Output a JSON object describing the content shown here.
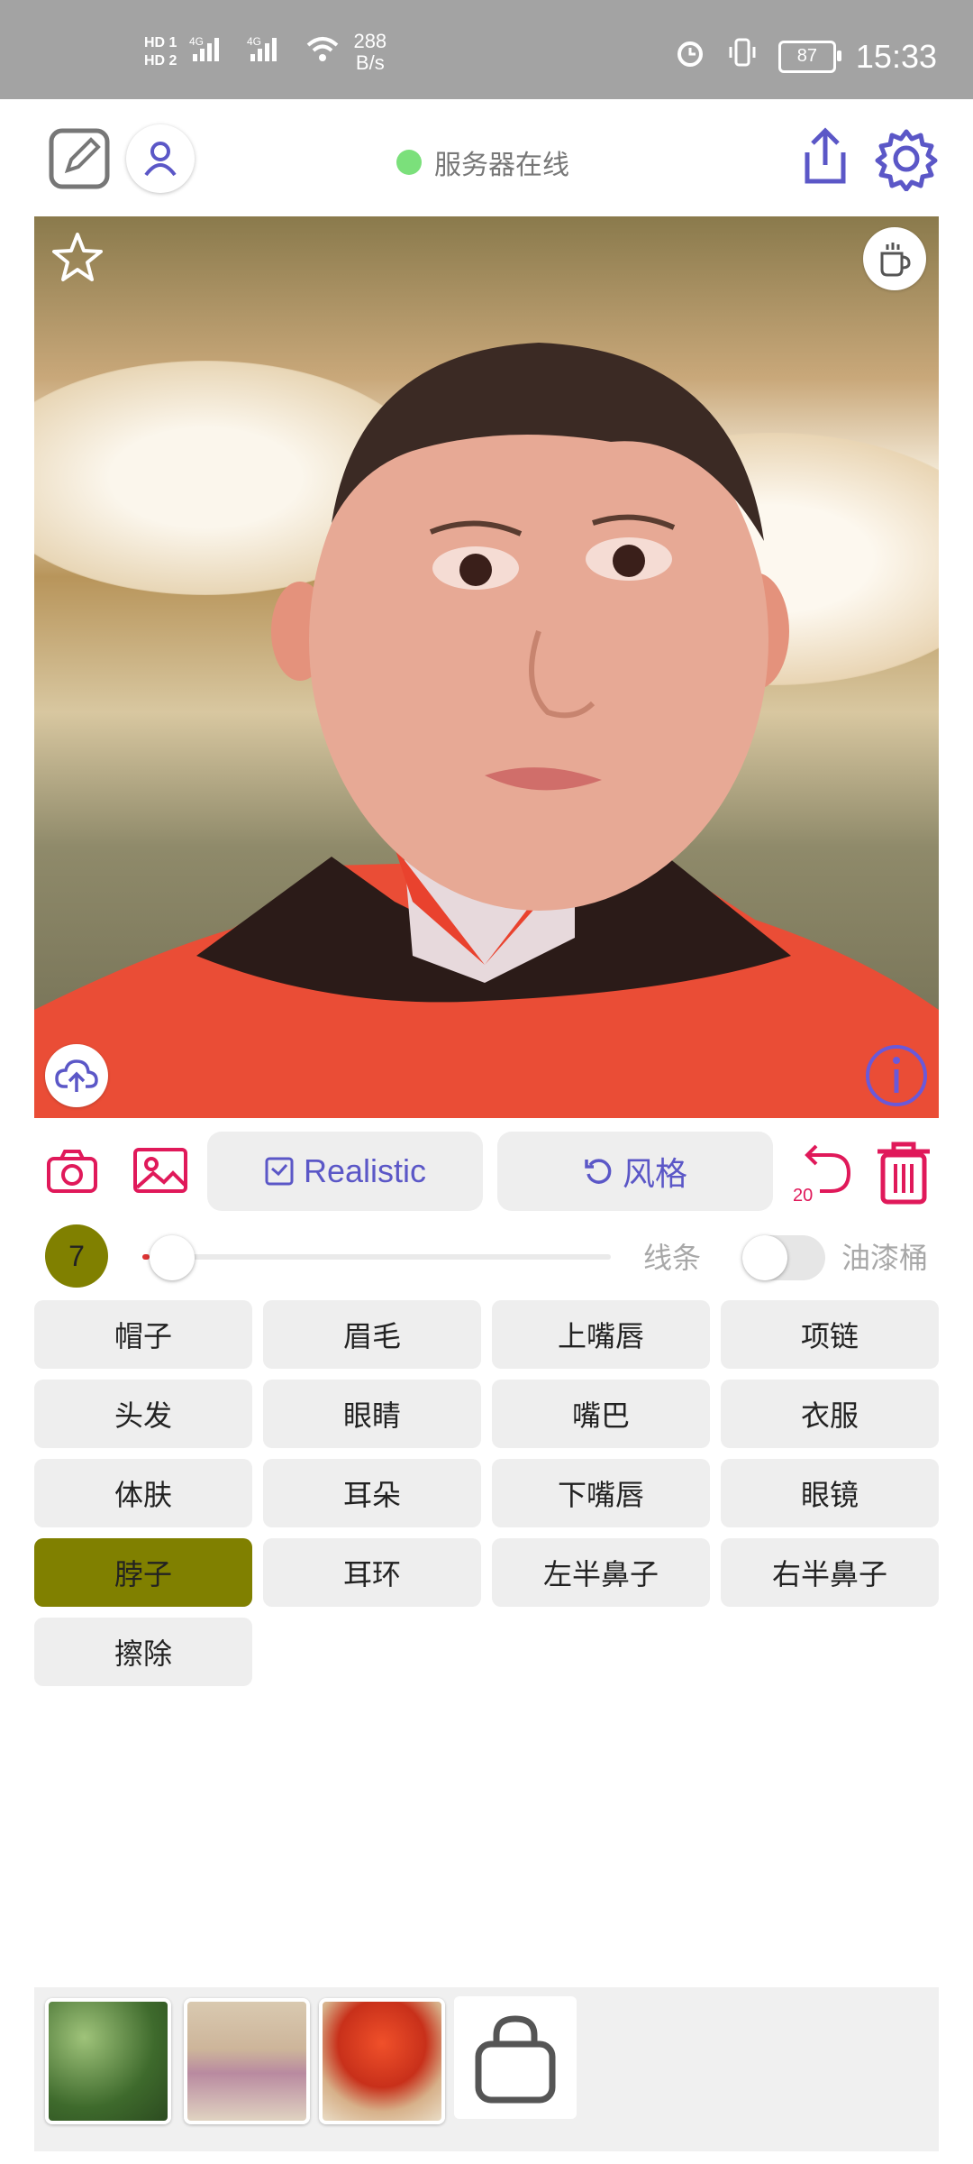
{
  "status_bar": {
    "network_speed_value": "288",
    "network_speed_unit": "B/s",
    "battery": "87",
    "time": "15:33"
  },
  "header": {
    "server_status": "服务器在线"
  },
  "canvas": {
    "brush_counter": "20"
  },
  "tools": {
    "realistic_label": "Realistic",
    "style_label": "风格"
  },
  "brush": {
    "size": "7",
    "line_label": "线条",
    "bucket_label": "油漆桶",
    "slider_level": 0.05,
    "bucket_enabled": false
  },
  "labels": [
    {
      "text": "帽子"
    },
    {
      "text": "眉毛"
    },
    {
      "text": "上嘴唇"
    },
    {
      "text": "项链"
    },
    {
      "text": "头发"
    },
    {
      "text": "眼睛"
    },
    {
      "text": "嘴巴"
    },
    {
      "text": "衣服"
    },
    {
      "text": "体肤"
    },
    {
      "text": "耳朵"
    },
    {
      "text": "下嘴唇"
    },
    {
      "text": "眼镜"
    },
    {
      "text": "脖子",
      "active": true
    },
    {
      "text": "耳环"
    },
    {
      "text": "左半鼻子"
    },
    {
      "text": "右半鼻子"
    },
    {
      "text": "擦除"
    }
  ],
  "colors": {
    "accent_pink": "#e0195a",
    "accent_purple": "#5b57c7",
    "active_label": "#808000"
  }
}
